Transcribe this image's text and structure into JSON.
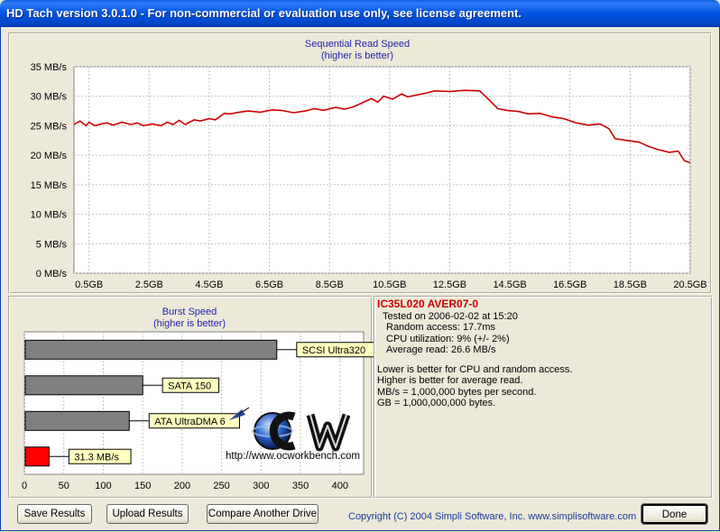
{
  "window": {
    "title": "HD Tach version 3.0.1.0  - For non-commercial or evaluation use only, see license agreement."
  },
  "colors": {
    "read_line": "#cc0000",
    "burst_user_bar": "#ff0000",
    "burst_ref_bar": "#808080",
    "label_fill": "#ffffc0",
    "info_drive": "#cc0000"
  },
  "chart_data": [
    {
      "type": "line",
      "title": "Sequential Read Speed",
      "subtitle": "(higher is better)",
      "xlabel": "",
      "ylabel": "",
      "y_unit": "MB/s",
      "ylim": [
        0,
        35
      ],
      "y_ticks": [
        0,
        5,
        10,
        15,
        20,
        25,
        30,
        35
      ],
      "y_tick_labels": [
        "0 MB/s",
        "5 MB/s",
        "10 MB/s",
        "15 MB/s",
        "20 MB/s",
        "25 MB/s",
        "30 MB/s",
        "35 MB/s"
      ],
      "xlim": [
        0,
        20.5
      ],
      "x_ticks": [
        0.5,
        2.5,
        4.5,
        6.5,
        8.5,
        10.5,
        12.5,
        14.5,
        16.5,
        18.5,
        20.5
      ],
      "x_tick_labels": [
        "0.5GB",
        "2.5GB",
        "4.5GB",
        "6.5GB",
        "8.5GB",
        "10.5GB",
        "12.5GB",
        "14.5GB",
        "16.5GB",
        "18.5GB",
        "20.5GB"
      ],
      "grid": true,
      "series": [
        {
          "color": "#cc0000",
          "x": [
            0,
            0.2,
            0.4,
            0.5,
            0.7,
            0.9,
            1.1,
            1.3,
            1.6,
            1.9,
            2.1,
            2.3,
            2.6,
            2.9,
            3.1,
            3.3,
            3.5,
            3.7,
            4.0,
            4.2,
            4.5,
            4.7,
            5.0,
            5.2,
            5.5,
            5.8,
            6.2,
            6.6,
            6.9,
            7.3,
            7.7,
            8.0,
            8.3,
            8.7,
            9.0,
            9.3,
            9.6,
            9.9,
            10.1,
            10.3,
            10.6,
            10.9,
            11.1,
            11.4,
            11.7,
            12.0,
            12.5,
            13.0,
            13.5,
            13.8,
            14.1,
            14.4,
            14.8,
            15.1,
            15.5,
            15.9,
            16.3,
            16.7,
            17.1,
            17.5,
            17.8,
            18.0,
            18.4,
            18.8,
            19.1,
            19.4,
            19.8,
            20.1,
            20.3,
            20.5
          ],
          "y": [
            25.2,
            25.8,
            25.0,
            25.6,
            25.0,
            25.3,
            25.5,
            25.1,
            25.6,
            25.2,
            25.5,
            25.0,
            25.3,
            25.0,
            25.6,
            25.2,
            25.9,
            25.2,
            26.0,
            25.8,
            26.2,
            26.0,
            27.1,
            27.0,
            27.3,
            27.5,
            27.3,
            27.7,
            27.6,
            27.2,
            27.5,
            27.9,
            27.6,
            28.1,
            27.8,
            28.2,
            28.9,
            29.6,
            29.0,
            30.0,
            29.5,
            30.4,
            29.9,
            30.2,
            30.5,
            30.9,
            30.8,
            31.0,
            30.9,
            29.4,
            27.9,
            27.6,
            27.4,
            27.0,
            27.1,
            26.5,
            26.2,
            25.5,
            25.1,
            25.3,
            24.5,
            22.8,
            22.5,
            22.2,
            21.5,
            21.0,
            20.5,
            20.7,
            19.1,
            18.7
          ]
        }
      ]
    },
    {
      "type": "bar",
      "orientation": "horizontal",
      "title": "Burst Speed",
      "subtitle": "(higher is better)",
      "xlabel": "",
      "ylabel": "",
      "xlim": [
        0,
        430
      ],
      "x_ticks": [
        0,
        50,
        100,
        150,
        200,
        250,
        300,
        350,
        400
      ],
      "grid": true,
      "categories": [
        "SCSI Ultra320",
        "SATA 150",
        "ATA UltraDMA 6",
        "31.3 MB/s"
      ],
      "values": [
        320,
        150,
        133,
        31.3
      ],
      "bar_colors": [
        "#808080",
        "#808080",
        "#808080",
        "#ff0000"
      ]
    }
  ],
  "info": {
    "drive": "IC35L020 AVER07-0",
    "tested": "Tested on 2006-02-02 at 15:20",
    "random_access": "Random access: 17.7ms",
    "cpu": "CPU utilization: 9% (+/- 2%)",
    "avg_read": "Average read: 26.6 MB/s",
    "note1": "Lower is better for CPU and random access.",
    "note2": "Higher is better for average read.",
    "note3": "MB/s = 1,000,000 bytes per second.",
    "note4": "GB = 1,000,000,000 bytes."
  },
  "logo": {
    "text": "OCW",
    "url": "http://www.ocworkbench.com"
  },
  "buttons": {
    "save": "Save Results",
    "upload": "Upload Results",
    "compare": "Compare Another Drive",
    "done": "Done"
  },
  "copyright": "Copyright (C) 2004 Simpli Software, Inc. www.simplisoftware.com"
}
